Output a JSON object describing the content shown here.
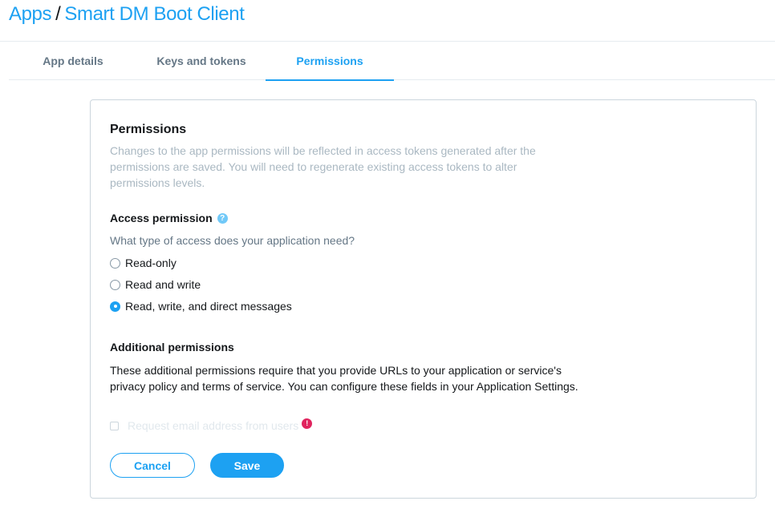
{
  "breadcrumb": {
    "root": "Apps",
    "separator": "/",
    "current": "Smart DM Boot Client"
  },
  "tabs": [
    {
      "label": "App details",
      "active": false
    },
    {
      "label": "Keys and tokens",
      "active": false
    },
    {
      "label": "Permissions",
      "active": true
    }
  ],
  "permissions": {
    "title": "Permissions",
    "description": "Changes to the app permissions will be reflected in access tokens generated after the permissions are saved. You will need to regenerate existing access tokens to alter permissions levels.",
    "access": {
      "title": "Access permission",
      "help_icon": "?",
      "question": "What type of access does your application need?",
      "options": [
        {
          "label": "Read-only",
          "checked": false
        },
        {
          "label": "Read and write",
          "checked": false
        },
        {
          "label": "Read, write, and direct messages",
          "checked": true
        }
      ]
    },
    "additional": {
      "title": "Additional permissions",
      "description": "These additional permissions require that you provide URLs to your application or service's privacy policy and terms of service. You can configure these fields in your Application Settings.",
      "email_checkbox_label": "Request email address from users",
      "email_checkbox_checked": false,
      "email_checkbox_disabled": true,
      "warning_icon": "!"
    }
  },
  "buttons": {
    "cancel": "Cancel",
    "save": "Save"
  },
  "colors": {
    "accent": "#1da1f2",
    "warning": "#e0245e",
    "muted_text": "#aab8c2"
  }
}
